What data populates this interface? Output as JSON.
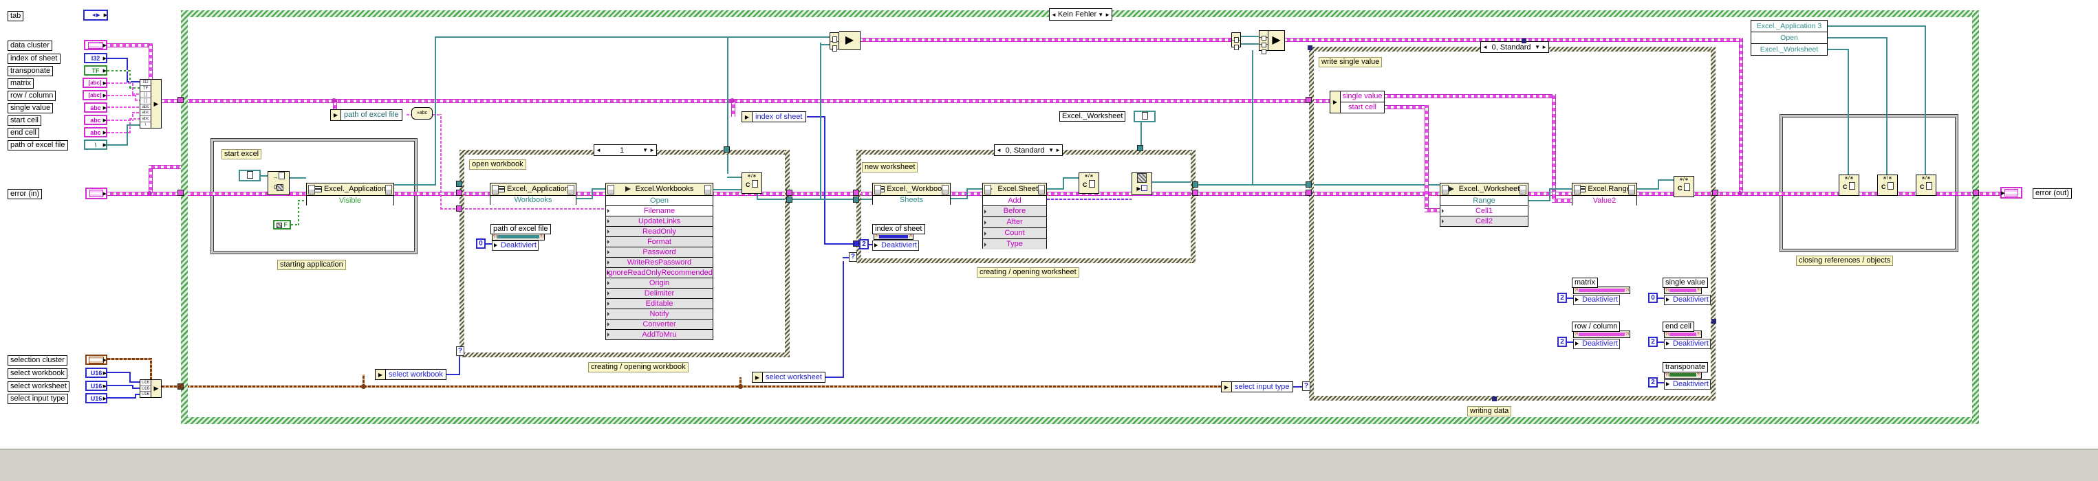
{
  "icons": {
    "arrow_left": "◄",
    "arrow_right": "►",
    "arrow_down": "▼",
    "arrow_out": "▶",
    "q": "?",
    "marks": "?!",
    "asterisks": "∗/∗",
    "c_label": "C",
    "tab_glyphs": "◄▶",
    "conv": "»abc",
    "arrow_plain": "→",
    "backslash": "\\"
  },
  "selectors": {
    "main": "Kein Fehler",
    "workbook": "1",
    "worksheet": "0, Standard",
    "write": "0, Standard"
  },
  "deakt": "Deaktiviert",
  "left": {
    "tab_label": "tab",
    "rows": [
      {
        "label": "data cluster",
        "type": ""
      },
      {
        "label": "index of sheet",
        "type": "I32"
      },
      {
        "label": "transponate",
        "type": "TF"
      },
      {
        "label": "matrix",
        "type": "[abc]"
      },
      {
        "label": "row / column",
        "type": "[abc]"
      },
      {
        "label": "single value",
        "type": "abc"
      },
      {
        "label": "start cell",
        "type": "abc"
      },
      {
        "label": "end cell",
        "type": "abc"
      },
      {
        "label": "path of excel file",
        "type": "\\"
      }
    ],
    "error_in": "error (in)",
    "sel_rows": [
      {
        "label": "selection cluster",
        "type": ""
      },
      {
        "label": "select workbook",
        "type": "U16"
      },
      {
        "label": "select worksheet",
        "type": "U16"
      },
      {
        "label": "select input type",
        "type": "U16"
      }
    ],
    "bundle_cells": [
      "I32",
      "TF",
      "[ ]",
      "[ ]",
      "abc",
      "abc",
      "abc",
      "\\"
    ],
    "bundle2_cells": [
      "U16",
      "U16",
      "U16"
    ]
  },
  "start_section": {
    "frame_label": "starting application",
    "comment": "start excel",
    "prop_title": "Excel._Application",
    "prop_row": "Visible",
    "bool_const": "F",
    "auto_open_zero": "0"
  },
  "workbook_section": {
    "comment": "open workbook",
    "label": "creating / opening workbook",
    "prop_title": "Excel._Application",
    "prop_row": "Workbooks",
    "invoke_title": "Excel.Workbooks",
    "invoke_method": "Open",
    "params": [
      "Filename",
      "UpdateLinks",
      "ReadOnly",
      "Format",
      "Password",
      "WriteResPassword",
      "IgnoreReadOnlyRecommended",
      "Origin",
      "Delimiter",
      "Editable",
      "Notify",
      "Converter",
      "AddToMru"
    ],
    "local_label": "path of excel file",
    "local_const": "0",
    "unbundle": "select workbook",
    "path_unbundle": "path of excel file"
  },
  "worksheet_section": {
    "comment": "new worksheet",
    "label": "creating / opening worksheet",
    "prop_title": "Excel._Workbook",
    "prop_row": "Sheets",
    "invoke_title": "Excel.Sheets",
    "invoke_method": "Add",
    "params": [
      "Before",
      "After",
      "Count",
      "Type"
    ],
    "local_label": "index of sheet",
    "local_const": "2",
    "unbundle": "select worksheet",
    "index_unbundle": "index of sheet",
    "ws_ref_label": "Excel._Worksheet"
  },
  "write_section": {
    "comment": "write single value",
    "label": "writing data",
    "unbundle_rows": [
      "single value",
      "start cell"
    ],
    "invoke_title": "Excel._Worksheet",
    "invoke_method": "Range",
    "params": [
      "Cell1",
      "Cell2"
    ],
    "prop_title": "Excel.Range",
    "prop_row": "Value2",
    "locals": [
      {
        "label": "matrix",
        "const": "2"
      },
      {
        "label": "row / column",
        "const": "2"
      },
      {
        "label": "single value",
        "const": "0"
      },
      {
        "label": "end cell",
        "const": "2"
      },
      {
        "label": "transponate",
        "const": "2"
      }
    ],
    "unbundle": "select input type"
  },
  "closing_section": {
    "label": "closing references / objects",
    "refs": [
      "Excel._Application 3",
      "Open",
      "Excel._Worksheet"
    ]
  },
  "error_out": "error (out)"
}
